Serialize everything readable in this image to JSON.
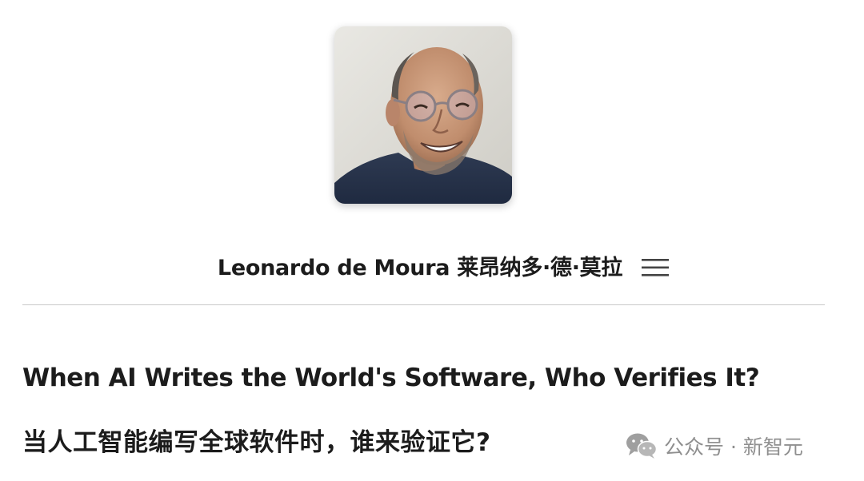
{
  "author": {
    "avatar_icon": "portrait-photo",
    "name": "Leonardo de Moura  莱昂纳多·德·莫拉",
    "menu_icon": "hamburger-menu-icon"
  },
  "article": {
    "title_en": "When AI Writes the World's Software, Who Verifies It?",
    "title_zh": "当人工智能编写全球软件时，谁来验证它?"
  },
  "watermark": {
    "icon": "wechat-icon",
    "text": "公众号 · 新智元"
  }
}
